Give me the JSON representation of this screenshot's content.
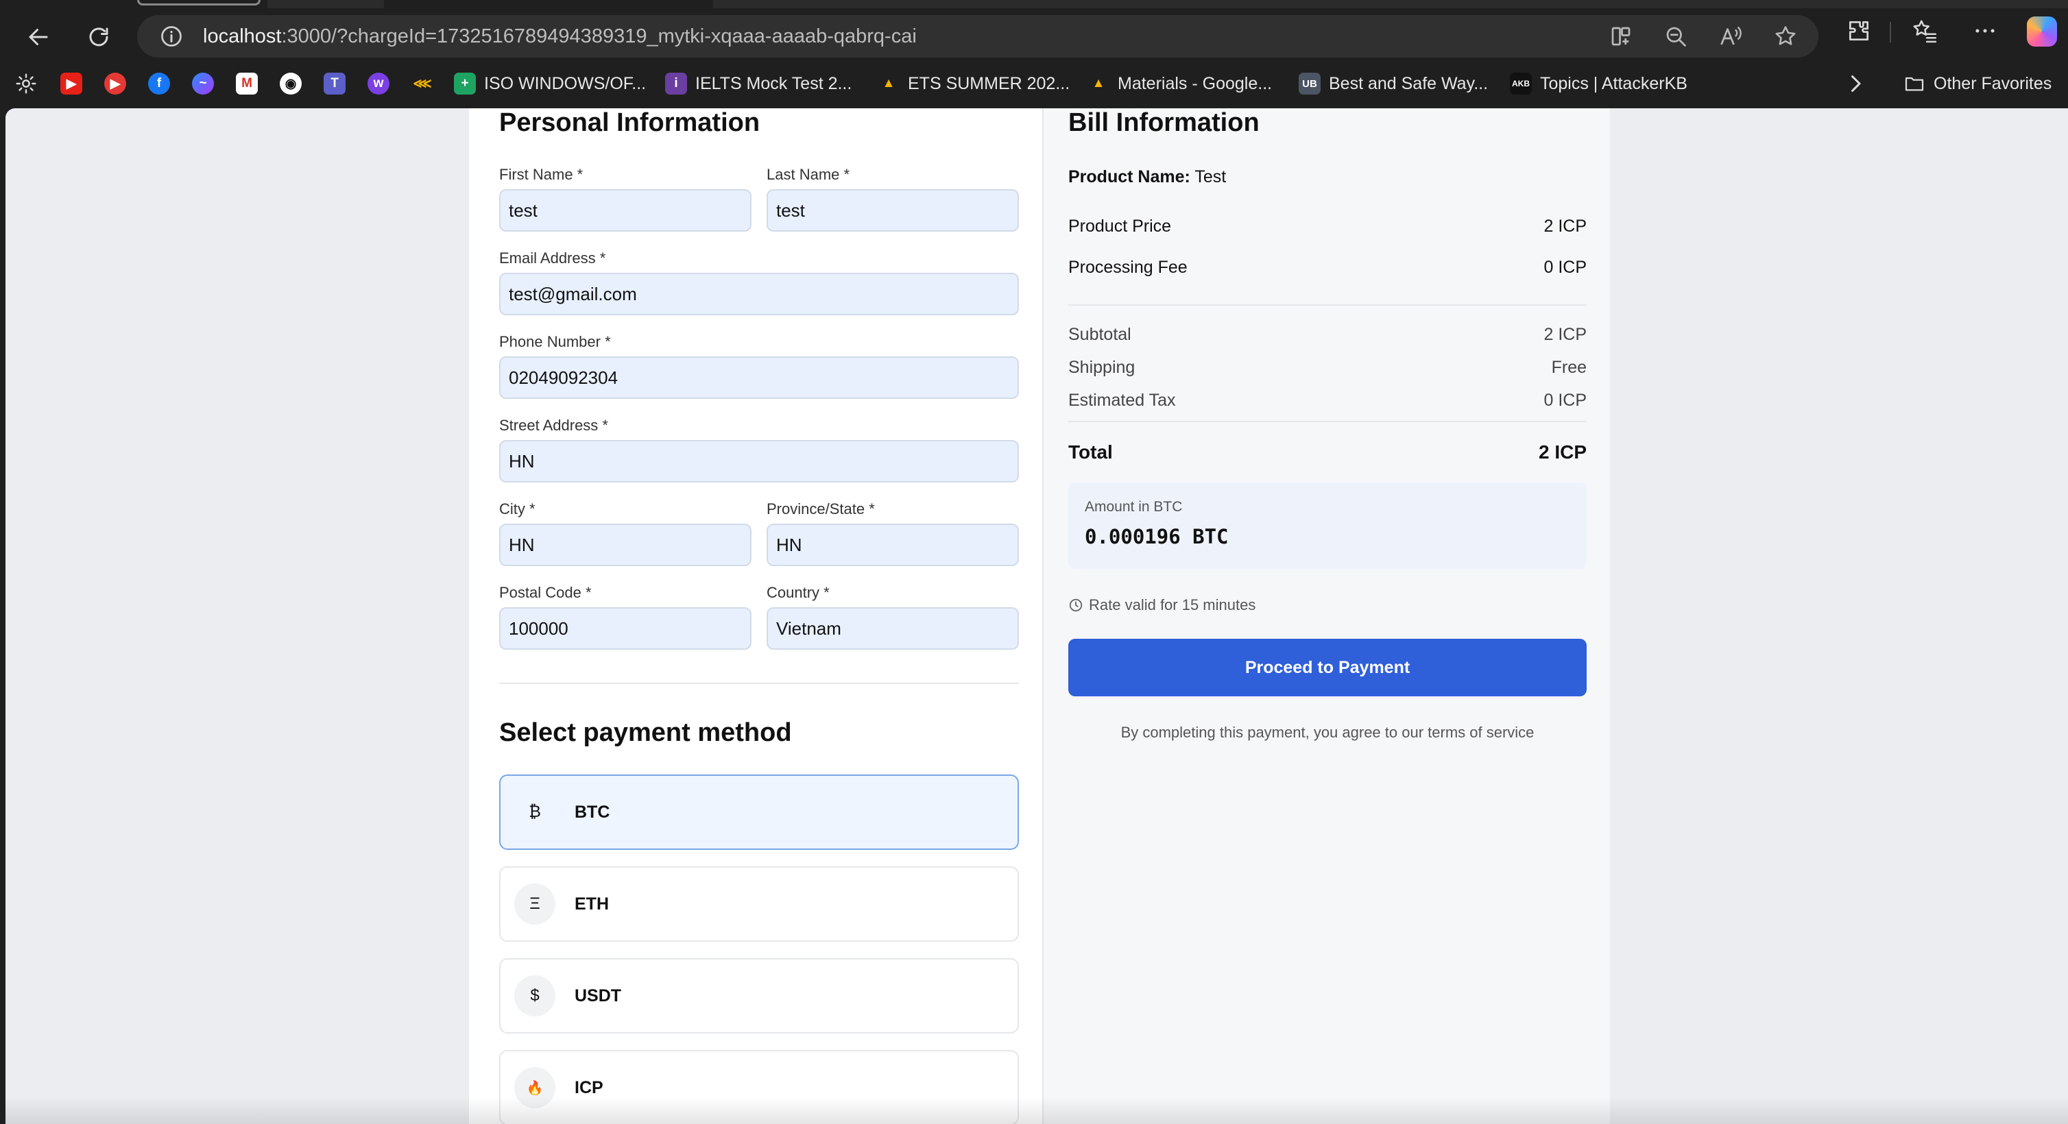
{
  "browser": {
    "url_host": "localhost",
    "url_rest": ":3000/?chargeId=1732516789494389319_mytki-xqaaa-aaaab-qabrq-cai",
    "favorites": [
      {
        "label": "ISO WINDOWS/OF...",
        "icon": "plus-sheet-icon",
        "color": "#1ea362"
      },
      {
        "label": "IELTS Mock Test 2...",
        "icon": "ielts-icon",
        "color": "#6b3fa0"
      },
      {
        "label": "ETS SUMMER 202...",
        "icon": "google-drive-icon",
        "color": "#f4b400"
      },
      {
        "label": "Materials - Google...",
        "icon": "google-drive-icon",
        "color": "#f4b400"
      },
      {
        "label": "Best and Safe Way...",
        "icon": "ub-icon",
        "color": "#4b5563"
      },
      {
        "label": "Topics | AttackerKB",
        "icon": "akb-icon",
        "color": "#111111"
      }
    ],
    "other_favorites": "Other Favorites"
  },
  "personal": {
    "title": "Personal Information",
    "first_name_label": "First Name *",
    "first_name": "test",
    "last_name_label": "Last Name *",
    "last_name": "test",
    "email_label": "Email Address *",
    "email": "test@gmail.com",
    "phone_label": "Phone Number *",
    "phone": "02049092304",
    "street_label": "Street Address *",
    "street": "HN",
    "city_label": "City *",
    "city": "HN",
    "province_label": "Province/State *",
    "province": "HN",
    "postal_label": "Postal Code *",
    "postal": "100000",
    "country_label": "Country *",
    "country": "Vietnam"
  },
  "payment": {
    "title": "Select payment method",
    "methods": [
      {
        "symbol": "₿",
        "label": "BTC",
        "selected": true
      },
      {
        "symbol": "Ξ",
        "label": "ETH",
        "selected": false
      },
      {
        "symbol": "$",
        "label": "USDT",
        "selected": false
      },
      {
        "symbol": "🔥",
        "label": "ICP",
        "selected": false
      }
    ]
  },
  "bill": {
    "title": "Bill Information",
    "product_name_label": "Product Name:",
    "product_name": "Test",
    "product_price_label": "Product Price",
    "product_price": "2 ICP",
    "processing_fee_label": "Processing Fee",
    "processing_fee": "0 ICP",
    "subtotal_label": "Subtotal",
    "subtotal": "2 ICP",
    "shipping_label": "Shipping",
    "shipping": "Free",
    "tax_label": "Estimated Tax",
    "tax": "0 ICP",
    "total_label": "Total",
    "total": "2 ICP",
    "amount_label": "Amount in BTC",
    "amount_value": "0.000196 BTC",
    "rate_note": "Rate valid for 15 minutes",
    "proceed_label": "Proceed to Payment",
    "terms": "By completing this payment, you agree to our terms of service"
  }
}
